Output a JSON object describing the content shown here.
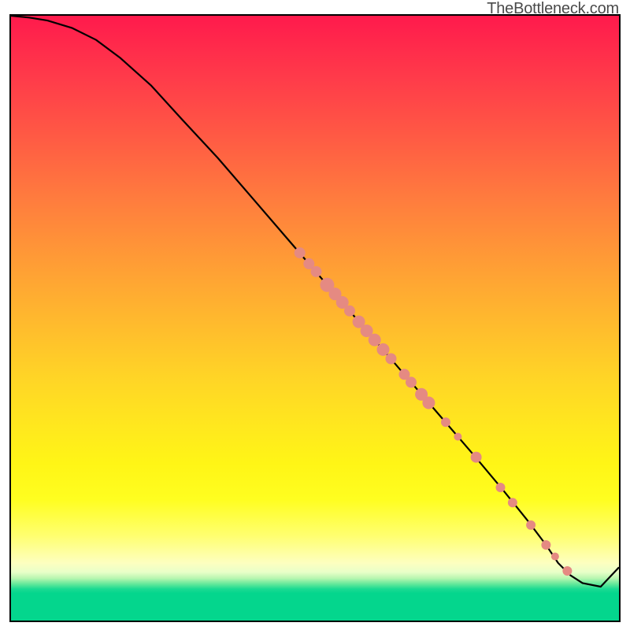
{
  "watermark": {
    "text": "TheBottleneck.com"
  },
  "chart_data": {
    "type": "line",
    "title": "",
    "xlabel": "",
    "ylabel": "",
    "xlim": [
      0,
      100
    ],
    "ylim": [
      0,
      100
    ],
    "grid": false,
    "legend": false,
    "series": [
      {
        "name": "curve",
        "x": [
          0,
          3,
          6,
          10,
          14,
          18,
          23,
          28,
          34,
          40,
          46,
          52,
          58,
          64,
          70,
          76,
          81,
          85,
          88,
          90,
          92,
          94,
          97,
          100
        ],
        "y": [
          100,
          99.7,
          99.2,
          98.0,
          96.0,
          93.0,
          88.5,
          83.0,
          76.5,
          69.5,
          62.5,
          55.5,
          48.5,
          41.5,
          34.5,
          27.5,
          21.5,
          16.5,
          12.5,
          9.5,
          7.5,
          6.2,
          5.6,
          8.8
        ]
      }
    ],
    "markers": {
      "name": "highlighted-points",
      "color": "#e58a82",
      "points": [
        {
          "x": 47.5,
          "y": 60.8,
          "r": 7
        },
        {
          "x": 49.0,
          "y": 59.0,
          "r": 7
        },
        {
          "x": 50.2,
          "y": 57.7,
          "r": 7
        },
        {
          "x": 52.0,
          "y": 55.5,
          "r": 9
        },
        {
          "x": 53.3,
          "y": 54.0,
          "r": 8
        },
        {
          "x": 54.5,
          "y": 52.6,
          "r": 8
        },
        {
          "x": 55.7,
          "y": 51.2,
          "r": 7
        },
        {
          "x": 57.2,
          "y": 49.4,
          "r": 8
        },
        {
          "x": 58.5,
          "y": 47.9,
          "r": 8
        },
        {
          "x": 59.8,
          "y": 46.4,
          "r": 8
        },
        {
          "x": 61.2,
          "y": 44.8,
          "r": 8
        },
        {
          "x": 62.5,
          "y": 43.3,
          "r": 7
        },
        {
          "x": 64.7,
          "y": 40.7,
          "r": 7
        },
        {
          "x": 65.8,
          "y": 39.4,
          "r": 7
        },
        {
          "x": 67.5,
          "y": 37.4,
          "r": 8
        },
        {
          "x": 68.7,
          "y": 36.0,
          "r": 8
        },
        {
          "x": 71.5,
          "y": 32.8,
          "r": 6
        },
        {
          "x": 73.5,
          "y": 30.4,
          "r": 5
        },
        {
          "x": 76.5,
          "y": 27.0,
          "r": 7
        },
        {
          "x": 80.5,
          "y": 22.0,
          "r": 6
        },
        {
          "x": 82.5,
          "y": 19.5,
          "r": 6
        },
        {
          "x": 85.5,
          "y": 15.8,
          "r": 6
        },
        {
          "x": 88.0,
          "y": 12.5,
          "r": 6
        },
        {
          "x": 89.5,
          "y": 10.6,
          "r": 5
        },
        {
          "x": 91.5,
          "y": 8.2,
          "r": 6
        }
      ]
    }
  }
}
